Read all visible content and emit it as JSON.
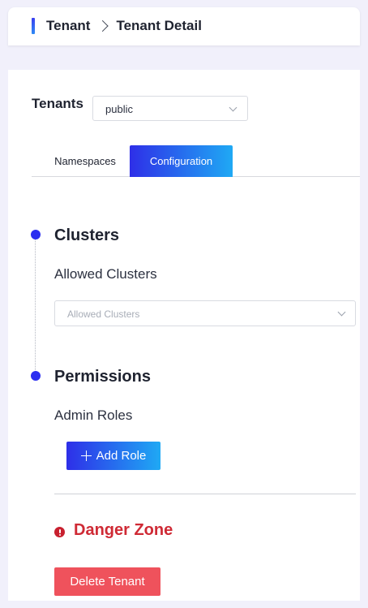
{
  "breadcrumb": {
    "root": "Tenant",
    "current": "Tenant Detail"
  },
  "tenant_selector": {
    "label": "Tenants",
    "selected": "public"
  },
  "tabs": [
    {
      "label": "Namespaces",
      "active": false
    },
    {
      "label": "Configuration",
      "active": true
    }
  ],
  "clusters": {
    "title": "Clusters",
    "field_label": "Allowed Clusters",
    "placeholder": "Allowed Clusters"
  },
  "permissions": {
    "title": "Permissions",
    "field_label": "Admin Roles",
    "add_button": "Add Role"
  },
  "danger_zone": {
    "title": "Danger Zone",
    "delete_button": "Delete Tenant"
  },
  "icons": {
    "breadcrumb_separator": "chevron-right-icon",
    "select_arrow": "chevron-down-icon",
    "add": "plus-icon",
    "danger": "exclamation-circle-icon"
  },
  "colors": {
    "accent": "#2e2fe8",
    "accent_gradient_end": "#1fa9f4",
    "danger": "#cf2a35",
    "danger_button": "#ef525c"
  }
}
